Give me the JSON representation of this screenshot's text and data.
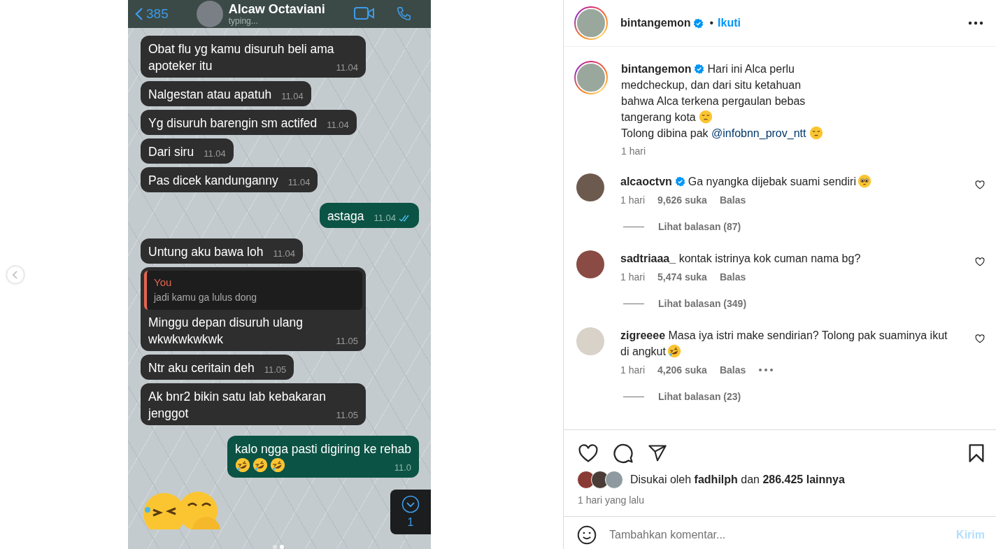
{
  "carousel": {
    "dots": [
      {
        "selected": false
      },
      {
        "selected": true
      }
    ]
  },
  "chat": {
    "back_count": "385",
    "contact": "Alcaw Octaviani",
    "status": "typing...",
    "unread": "1",
    "messages": [
      {
        "kind": "in",
        "text": "Obat flu yg kamu disuruh beli ama apoteker itu",
        "time": "11.04"
      },
      {
        "kind": "in",
        "text": "Nalgestan atau apatuh",
        "time": "11.04"
      },
      {
        "kind": "in",
        "text": "Yg disuruh barengin sm actifed",
        "time": "11.04"
      },
      {
        "kind": "in",
        "text": "Dari siru",
        "time": "11.04"
      },
      {
        "kind": "in",
        "text": "Pas dicek kandunganny",
        "time": "11.04"
      },
      {
        "kind": "out",
        "text": "astaga",
        "time": "11.04",
        "read": true
      },
      {
        "kind": "in",
        "text": "Untung aku bawa loh",
        "time": "11.04"
      },
      {
        "kind": "in",
        "reply": {
          "author": "You",
          "text": "jadi kamu ga lulus dong"
        },
        "text": "Minggu depan disuruh ulang wkwkwkwkwk",
        "time": "11.05"
      },
      {
        "kind": "in",
        "text": "Ntr aku ceritain deh",
        "time": "11.05"
      },
      {
        "kind": "in",
        "text": "Ak bnr2 bikin satu lab kebakaran jenggot",
        "time": "11.05"
      },
      {
        "kind": "out",
        "text": "kalo ngga pasti digiring ke rehab",
        "time": "11.0",
        "read": false
      }
    ]
  },
  "post": {
    "username": "bintangemon",
    "verified": true,
    "separator": "•",
    "follow": "Ikuti",
    "caption": {
      "username": "bintangemon",
      "verified": true,
      "text": "Hari ini Alca perlu medcheckup, dan dari situ ketahuan bahwa Alca terkena pergaulan bebas tangerang kota",
      "line2": "Tolong dibina pak",
      "mention": "@infobnn_prov_ntt",
      "time": "1 hari"
    },
    "comments": [
      {
        "username": "alcaoctvn",
        "verified": true,
        "text": "Ga nyangka dijebak suami sendiri",
        "time": "1 hari",
        "likes": "9,626 suka",
        "reply": "Balas",
        "more": false,
        "replies": "Lihat balasan (87)"
      },
      {
        "username": "sadtriaaa_",
        "verified": false,
        "text": "kontak istrinya kok cuman nama bg?",
        "time": "1 hari",
        "likes": "5,474 suka",
        "reply": "Balas",
        "more": false,
        "replies": "Lihat balasan (349)"
      },
      {
        "username": "zigreeee",
        "verified": false,
        "text": "Masa iya istri make sendirian? Tolong pak suaminya ikut di angkut",
        "time": "1 hari",
        "likes": "4,206 suka",
        "reply": "Balas",
        "more": true,
        "replies": "Lihat balasan (23)"
      }
    ],
    "likes_text": "Disukai oleh **fadhilph** dan **286.425 lainnya**",
    "posted": "1 hari yang lalu",
    "comment_box": {
      "placeholder": "Tambahkan komentar...",
      "send": "Kirim",
      "send_disabled": true
    }
  }
}
